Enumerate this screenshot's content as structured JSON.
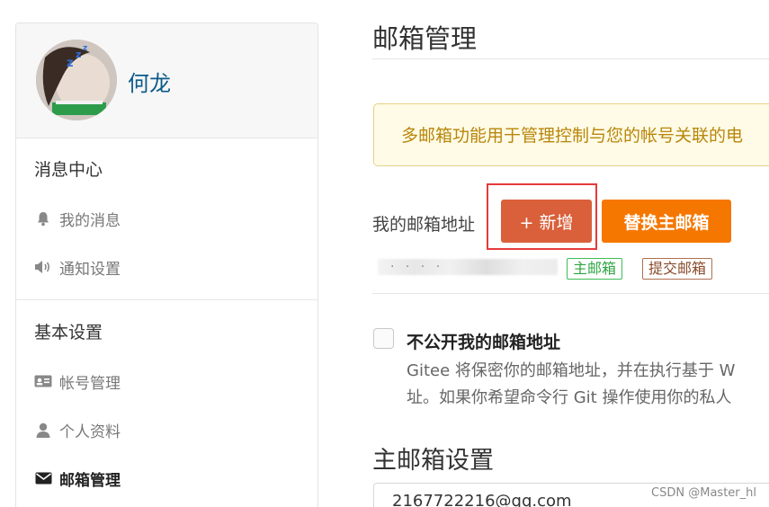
{
  "sidebar": {
    "username": "何龙",
    "sections": [
      {
        "title": "消息中心",
        "items": [
          {
            "label": "我的消息",
            "icon": "bell-icon"
          },
          {
            "label": "通知设置",
            "icon": "speaker-icon"
          }
        ]
      },
      {
        "title": "基本设置",
        "items": [
          {
            "label": "帐号管理",
            "icon": "id-card-icon"
          },
          {
            "label": "个人资料",
            "icon": "user-icon"
          },
          {
            "label": "邮箱管理",
            "icon": "envelope-icon",
            "active": true
          }
        ]
      }
    ]
  },
  "main": {
    "title": "邮箱管理",
    "notice": "多邮箱功能用于管理控制与您的帐号关联的电",
    "email_label": "我的邮箱地址",
    "add_button": "+ 新增",
    "replace_button": "替换主邮箱",
    "blurred_email": "· · · ·",
    "tags": {
      "primary": "主邮箱",
      "submit": "提交邮箱"
    },
    "private_checkbox_label": "不公开我的邮箱地址",
    "private_desc_line1": "Gitee 将保密你的邮箱地址，并在执行基于 W",
    "private_desc_line2": "址。如果你希望命令行 Git 操作使用你的私人",
    "primary_section_title": "主邮箱设置",
    "primary_email_value": "2167722216@qq.com"
  },
  "watermark": "CSDN @Master_hl",
  "colors": {
    "add_button": "#d9603a",
    "replace_button": "#f57700",
    "highlight_frame": "#e53a3a",
    "notice_bg": "#fffbe6",
    "notice_text": "#b8860b",
    "username": "#0d5a8a"
  }
}
